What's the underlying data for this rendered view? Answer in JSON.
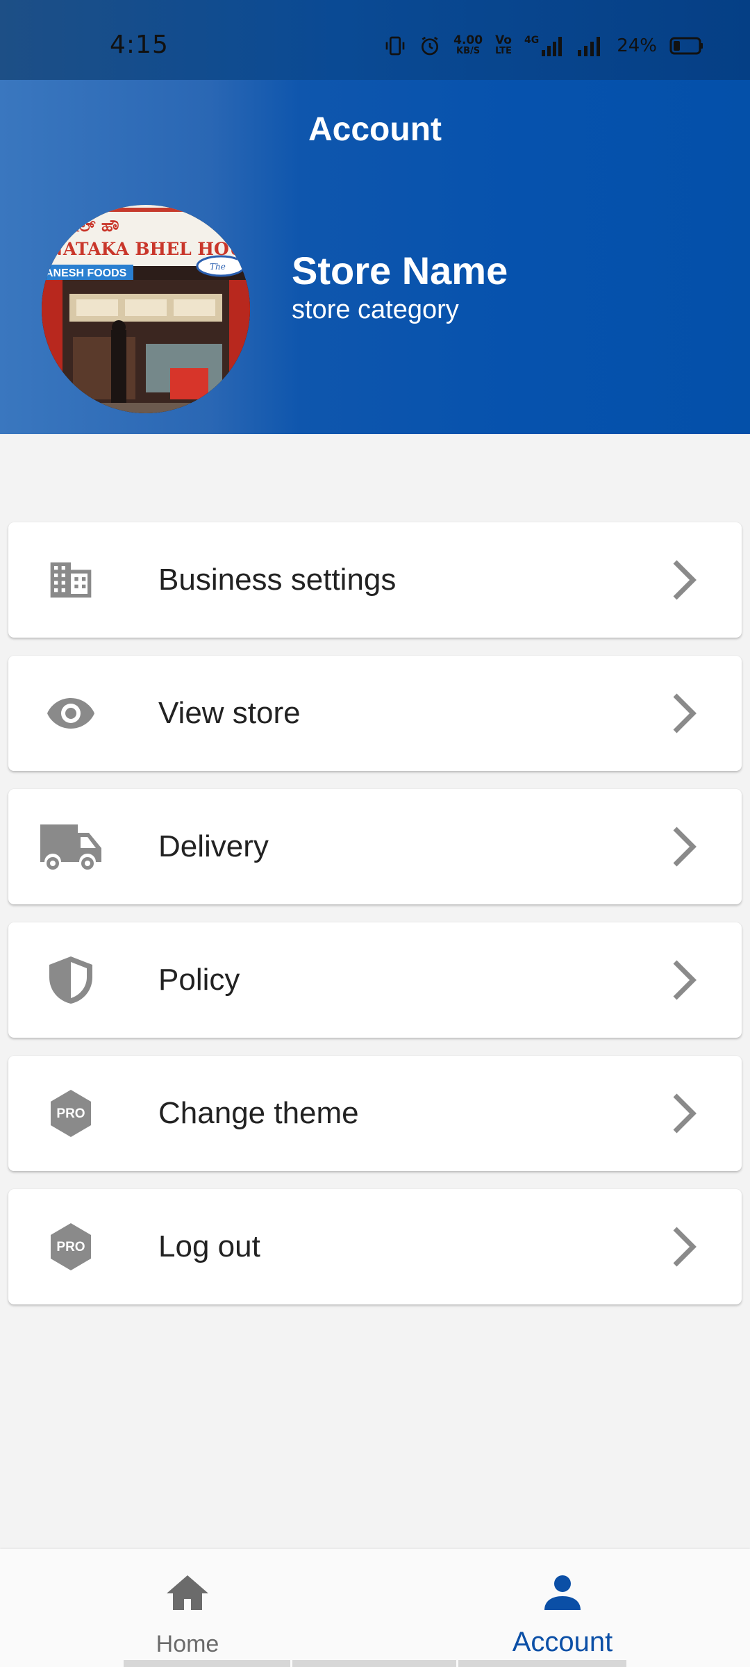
{
  "status_bar": {
    "time": "4:15",
    "net_speed_value": "4.00",
    "net_speed_unit": "KB/S",
    "volte_top": "Vo",
    "volte_bottom": "LTE",
    "network_type": "4G",
    "battery_percent": "24%"
  },
  "header": {
    "title": "Account",
    "store_name": "Store Name",
    "store_category": "store category",
    "avatar_sign_text": "NATAKA BHEL HOUSE",
    "avatar_sub_sign_text": "ANESH FOODS",
    "avatar_badge_text": "The"
  },
  "menu": {
    "items": [
      {
        "label": "Business settings",
        "icon": "building-icon"
      },
      {
        "label": "View store",
        "icon": "eye-icon"
      },
      {
        "label": "Delivery",
        "icon": "truck-icon"
      },
      {
        "label": "Policy",
        "icon": "shield-icon"
      },
      {
        "label": "Change theme",
        "icon": "pro-badge-icon",
        "badge": "PRO"
      },
      {
        "label": "Log out",
        "icon": "pro-badge-icon",
        "badge": "PRO"
      }
    ]
  },
  "bottom_nav": {
    "home_label": "Home",
    "account_label": "Account",
    "active": "Account"
  },
  "colors": {
    "header_blue": "#0652ad",
    "active_nav": "#0b4fa6",
    "icon_gray": "#8a8a8a",
    "text_dark": "#222222"
  }
}
